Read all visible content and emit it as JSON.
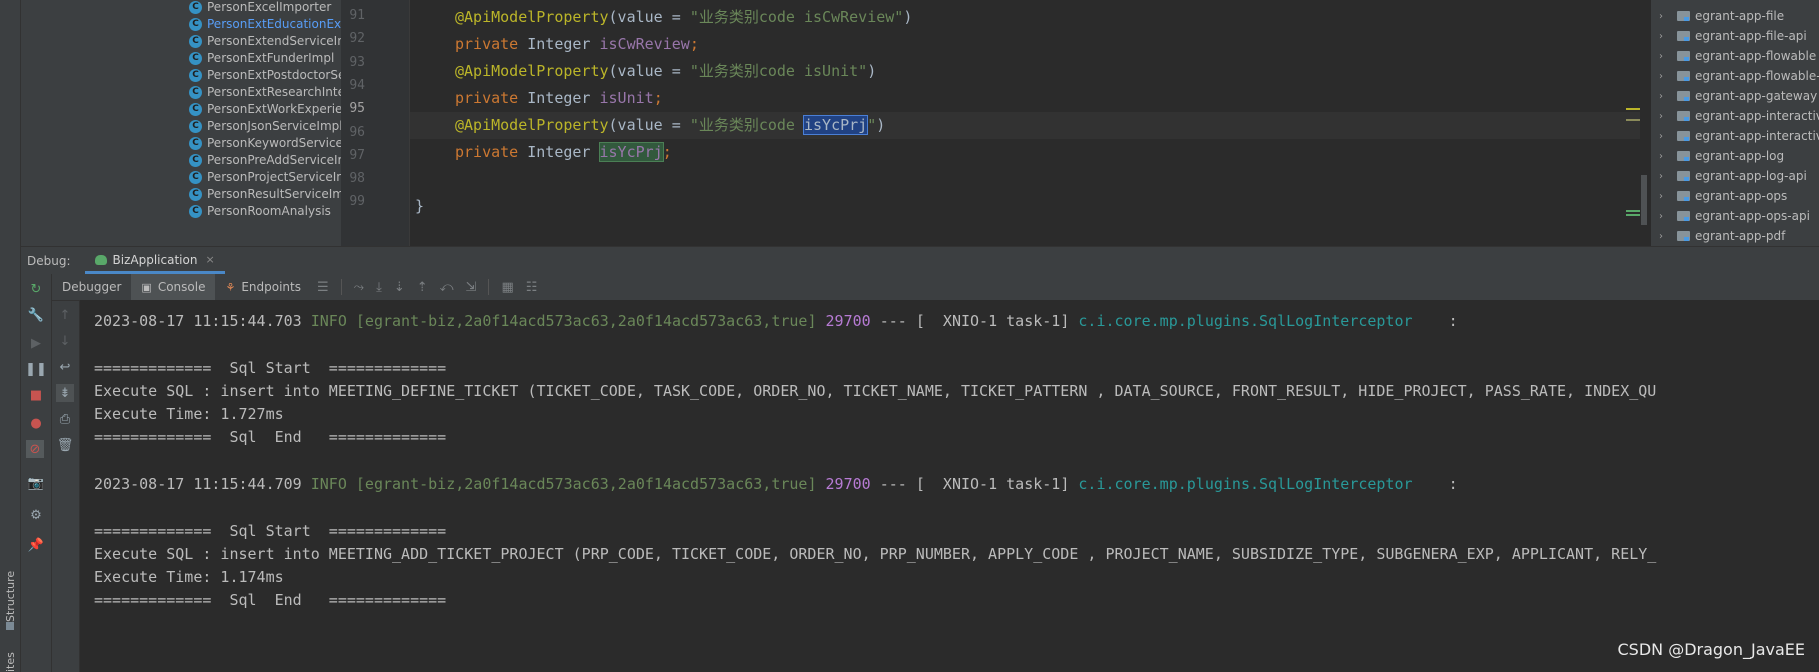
{
  "structure_strip": {
    "structure_label": "Structure",
    "favorites_label": "ites"
  },
  "project_tree": {
    "items": [
      {
        "label": "PersonExcelImporter",
        "icon": "C",
        "selected": false
      },
      {
        "label": "PersonExtEducationExp",
        "icon": "C",
        "selected": true
      },
      {
        "label": "PersonExtendServiceIm",
        "icon": "C",
        "selected": false
      },
      {
        "label": "PersonExtFunderImpl",
        "icon": "C",
        "selected": false
      },
      {
        "label": "PersonExtPostdoctorSe",
        "icon": "C",
        "selected": false
      },
      {
        "label": "PersonExtResearchInte",
        "icon": "C",
        "selected": false
      },
      {
        "label": "PersonExtWorkExperie",
        "icon": "C",
        "selected": false
      },
      {
        "label": "PersonJsonServiceImpl",
        "icon": "C",
        "selected": false
      },
      {
        "label": "PersonKeywordService",
        "icon": "C",
        "selected": false
      },
      {
        "label": "PersonPreAddServiceIr",
        "icon": "C",
        "selected": false
      },
      {
        "label": "PersonProjectServiceIn",
        "icon": "C",
        "selected": false
      },
      {
        "label": "PersonResultServiceIm",
        "icon": "C",
        "selected": false
      },
      {
        "label": "PersonRoomAnalysis",
        "icon": "C",
        "selected": false
      }
    ]
  },
  "gutter": {
    "line_numbers": [
      "91",
      "92",
      "93",
      "94",
      "95",
      "96",
      "97",
      "98",
      "99"
    ],
    "current_line": "95"
  },
  "editor": {
    "lines": {
      "l1": {
        "ann": "@ApiModelProperty",
        "open": "(value = ",
        "str": "\"业务类别code isCwReview\"",
        "close": ")"
      },
      "l2": {
        "kw": "private",
        "type": " Integer ",
        "field": "isCwReview",
        "end": ";"
      },
      "l3": {
        "ann": "@ApiModelProperty",
        "open": "(value = ",
        "str": "\"业务类别code isUnit\"",
        "close": ")"
      },
      "l4": {
        "kw": "private",
        "type": " Integer ",
        "field": "isUnit",
        "end": ";"
      },
      "l5": {
        "ann": "@ApiModelProperty",
        "open": "(value = ",
        "str_pre": "\"业务类别code ",
        "str_sel": "isYcPrj",
        "str_post": "\"",
        "close": ")"
      },
      "l6": {
        "kw": "private",
        "type": " Integer ",
        "field": "isYcPrj",
        "end": ";"
      },
      "l8": {
        "brace": "}"
      }
    }
  },
  "modules_tree": {
    "items": [
      "egrant-app-file",
      "egrant-app-file-api",
      "egrant-app-flowable",
      "egrant-app-flowable-",
      "egrant-app-gateway",
      "egrant-app-interactive",
      "egrant-app-interactive",
      "egrant-app-log",
      "egrant-app-log-api",
      "egrant-app-ops",
      "egrant-app-ops-api",
      "egrant-app-pdf"
    ]
  },
  "debug_header": {
    "label": "Debug:",
    "tab_label": "BizApplication",
    "close": "×"
  },
  "tabs_row": {
    "debugger": "Debugger",
    "console": "Console",
    "endpoints": "Endpoints"
  },
  "console": {
    "log1": {
      "timestamp": "2023-08-17 11:15:44.703",
      "level_trace": " INFO [egrant-biz,2a0f14acd573ac63,2a0f14acd573ac63,true]",
      "pid": " 29700",
      "thread": " --- [  XNIO-1 task-1] ",
      "logger": "c.i.core.mp.plugins.SqlLogInterceptor",
      "colon": "    :"
    },
    "sql1_start": "=============  Sql Start  =============",
    "sql1_exec": "Execute SQL : insert into MEETING_DEFINE_TICKET (TICKET_CODE, TASK_CODE, ORDER_NO, TICKET_NAME, TICKET_PATTERN , DATA_SOURCE, FRONT_RESULT, HIDE_PROJECT, PASS_RATE, INDEX_QU",
    "sql1_time": "Execute Time: 1.727ms",
    "sql1_end": "=============  Sql  End   =============",
    "log2": {
      "timestamp": "2023-08-17 11:15:44.709",
      "level_trace": " INFO [egrant-biz,2a0f14acd573ac63,2a0f14acd573ac63,true]",
      "pid": " 29700",
      "thread": " --- [  XNIO-1 task-1] ",
      "logger": "c.i.core.mp.plugins.SqlLogInterceptor",
      "colon": "    :"
    },
    "sql2_start": "=============  Sql Start  =============",
    "sql2_exec": "Execute SQL : insert into MEETING_ADD_TICKET_PROJECT (PRP_CODE, TICKET_CODE, ORDER_NO, PRP_NUMBER, APPLY_CODE , PROJECT_NAME, SUBSIDIZE_TYPE, SUBGENERA_EXP, APPLICANT, RELY_",
    "sql2_time": "Execute Time: 1.174ms",
    "sql2_end": "=============  Sql  End   ============="
  },
  "watermark": "CSDN @Dragon_JavaEE"
}
